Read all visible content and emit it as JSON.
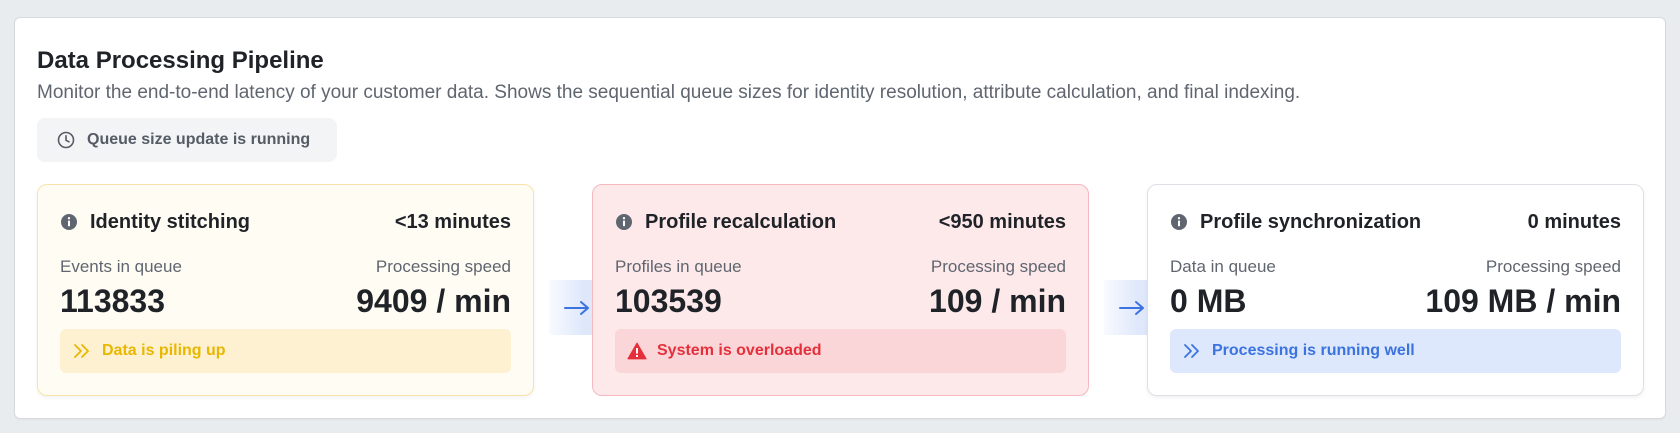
{
  "header": {
    "title": "Data Processing Pipeline",
    "subtitle": "Monitor the end-to-end latency of your customer data. Shows the sequential queue sizes for identity resolution, attribute calculation, and final indexing.",
    "status": "Queue size update is running"
  },
  "cards": [
    {
      "title": "Identity stitching",
      "eta": "<13 minutes",
      "queue_label": "Events in queue",
      "queue_value": "113833",
      "speed_label": "Processing speed",
      "speed_value": "9409 / min",
      "banner": "Data is piling up",
      "banner_icon": "double-chevron-right-icon",
      "status_color": "#e9b600"
    },
    {
      "title": "Profile recalculation",
      "eta": "<950 minutes",
      "queue_label": "Profiles in queue",
      "queue_value": "103539",
      "speed_label": "Processing speed",
      "speed_value": "109 / min",
      "banner": "System is overloaded",
      "banner_icon": "warning-triangle-icon",
      "status_color": "#e5303b"
    },
    {
      "title": "Profile synchronization",
      "eta": "0 minutes",
      "queue_label": "Data in queue",
      "queue_value": "0 MB",
      "speed_label": "Processing speed",
      "speed_value": "109 MB / min",
      "banner": "Processing is running well",
      "banner_icon": "double-chevron-right-icon",
      "status_color": "#3b73df"
    }
  ],
  "connectors": [
    "arrow-right-icon",
    "arrow-right-icon"
  ]
}
